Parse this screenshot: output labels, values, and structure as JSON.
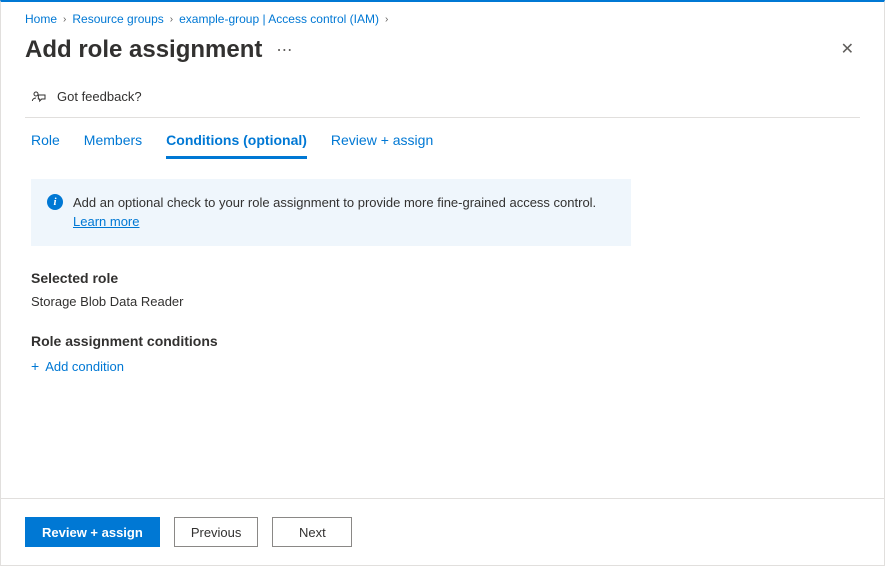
{
  "breadcrumb": {
    "items": [
      "Home",
      "Resource groups",
      "example-group | Access control (IAM)"
    ]
  },
  "header": {
    "title": "Add role assignment"
  },
  "feedback": {
    "label": "Got feedback?"
  },
  "tabs": {
    "items": [
      {
        "label": "Role"
      },
      {
        "label": "Members"
      },
      {
        "label": "Conditions (optional)"
      },
      {
        "label": "Review + assign"
      }
    ]
  },
  "info": {
    "text": "Add an optional check to your role assignment to provide more fine-grained access control. ",
    "learn_more": "Learn more"
  },
  "selected_role": {
    "label": "Selected role",
    "value": "Storage Blob Data Reader"
  },
  "conditions": {
    "label": "Role assignment conditions",
    "add_label": "Add condition"
  },
  "footer": {
    "primary": "Review + assign",
    "previous": "Previous",
    "next": "Next"
  }
}
